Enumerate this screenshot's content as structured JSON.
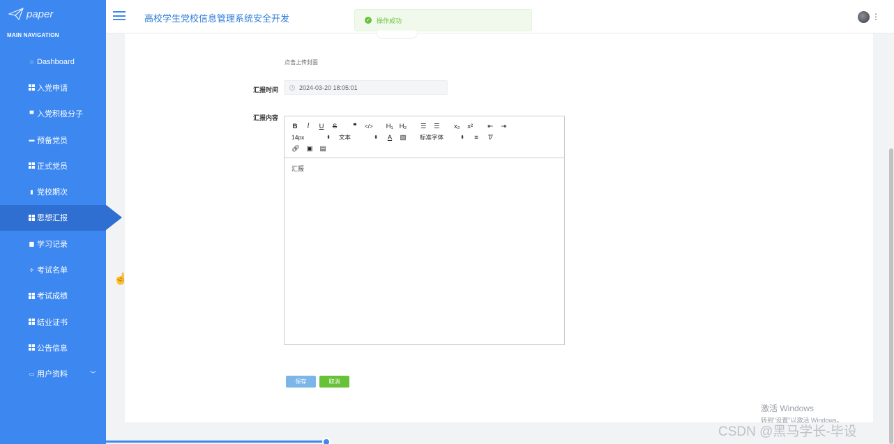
{
  "app": {
    "logo_text": "paper",
    "system_title": "高校学生党校信息管理系统安全开发"
  },
  "sidebar": {
    "heading": "MAIN NAVIGATION",
    "items": [
      {
        "label": "Dashboard",
        "icon": "home-icon"
      },
      {
        "label": "入党申请",
        "icon": "grid-icon"
      },
      {
        "label": "入党积极分子",
        "icon": "comment-icon"
      },
      {
        "label": "预备党员",
        "icon": "ticket-icon"
      },
      {
        "label": "正式党员",
        "icon": "grid-icon"
      },
      {
        "label": "党校期次",
        "icon": "bar-chart-icon"
      },
      {
        "label": "思想汇报",
        "icon": "grid-icon",
        "active": true
      },
      {
        "label": "学习记录",
        "icon": "lock-icon"
      },
      {
        "label": "考试名单",
        "icon": "sliders-icon"
      },
      {
        "label": "考试成绩",
        "icon": "grid-icon"
      },
      {
        "label": "结业证书",
        "icon": "grid-icon"
      },
      {
        "label": "公告信息",
        "icon": "grid-icon"
      },
      {
        "label": "用户资料",
        "icon": "card-icon",
        "expandable": true
      }
    ]
  },
  "toast": {
    "message": "操作成功",
    "color": "#67c23a"
  },
  "form": {
    "upload_hint": "点击上传封面",
    "report_time_label": "汇报时间",
    "report_time_value": "2024-03-20 18:05:01",
    "content_label": "汇报内容",
    "editor": {
      "font_size": "14px",
      "header_select": "文本",
      "font_family": "标准字体",
      "content": "汇报"
    },
    "save_label": "保存",
    "cancel_label": "取消"
  },
  "watermark": {
    "line1": "激活 Windows",
    "line2": "转到\"设置\"以激活 Windows。",
    "csdn": "CSDN @黑马学长-毕设"
  },
  "colors": {
    "sidebar": "#3c87f0",
    "accent": "#2b7bd8",
    "save": "#7cb6e8",
    "cancel": "#67c23a"
  }
}
